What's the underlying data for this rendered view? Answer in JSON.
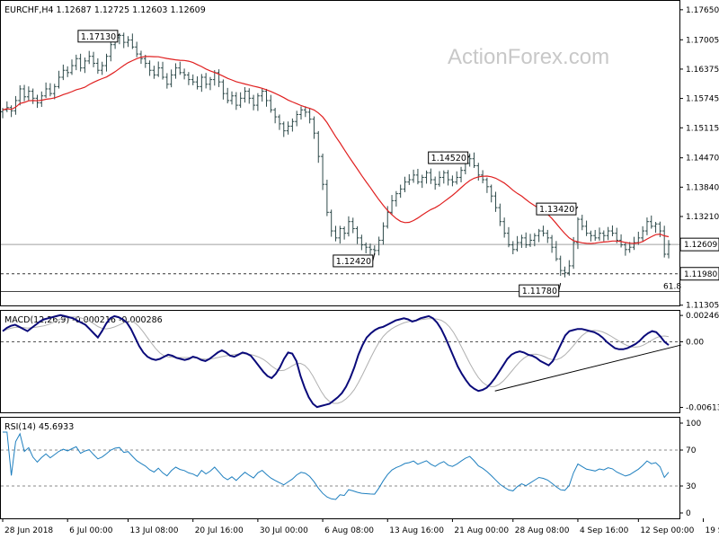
{
  "chart_data": [
    {
      "type": "candlestick",
      "name": "main",
      "symbol_header": "EURCHF,H4  1.12687  1.12725  1.12603  1.12609",
      "watermark": "ActionForex.com",
      "ylim": [
        1.113,
        1.1784
      ],
      "y_ticks": [
        "1.17650",
        "1.17005",
        "1.16375",
        "1.15745",
        "1.15115",
        "1.14470",
        "1.13840",
        "1.13210",
        "1.12580",
        "1.11950",
        "1.11305"
      ],
      "current_price": {
        "label": "1.12609",
        "value": 1.12609
      },
      "support_level": {
        "label": "1.11980",
        "value": 1.1198
      },
      "fib_level": {
        "label": "61.8",
        "value": 1.116
      },
      "annotations": [
        {
          "label": "1.17130",
          "bar": 27,
          "value": 1.1713
        },
        {
          "label": "1.14520",
          "bar": 108,
          "value": 1.1452
        },
        {
          "label": "1.12420",
          "bar": 86,
          "value": 1.1242
        },
        {
          "label": "1.13420",
          "bar": 133,
          "value": 1.1342
        },
        {
          "label": "1.11780",
          "bar": 129,
          "value": 1.1178
        }
      ],
      "close": [
        1.155,
        1.1555,
        1.1548,
        1.157,
        1.1595,
        1.1578,
        1.159,
        1.1575,
        1.1565,
        1.158,
        1.1595,
        1.1585,
        1.16,
        1.162,
        1.1635,
        1.163,
        1.1645,
        1.166,
        1.164,
        1.1655,
        1.1665,
        1.165,
        1.1635,
        1.1645,
        1.1665,
        1.169,
        1.1705,
        1.171,
        1.1695,
        1.17,
        1.1685,
        1.167,
        1.166,
        1.165,
        1.1635,
        1.1625,
        1.164,
        1.162,
        1.1605,
        1.1625,
        1.164,
        1.163,
        1.1625,
        1.1615,
        1.161,
        1.16,
        1.162,
        1.1605,
        1.1615,
        1.163,
        1.161,
        1.1585,
        1.157,
        1.158,
        1.156,
        1.1575,
        1.159,
        1.1575,
        1.156,
        1.158,
        1.159,
        1.157,
        1.155,
        1.1535,
        1.152,
        1.1505,
        1.1515,
        1.1525,
        1.154,
        1.155,
        1.1545,
        1.153,
        1.15,
        1.145,
        1.139,
        1.133,
        1.129,
        1.1275,
        1.1295,
        1.1285,
        1.131,
        1.1295,
        1.1275,
        1.126,
        1.1255,
        1.125,
        1.1248,
        1.127,
        1.13,
        1.133,
        1.1355,
        1.137,
        1.138,
        1.1395,
        1.14,
        1.141,
        1.1395,
        1.1405,
        1.1415,
        1.14,
        1.139,
        1.1405,
        1.1415,
        1.14,
        1.1395,
        1.1405,
        1.142,
        1.1435,
        1.1445,
        1.143,
        1.141,
        1.14,
        1.1385,
        1.1365,
        1.134,
        1.131,
        1.1285,
        1.126,
        1.125,
        1.1265,
        1.1275,
        1.126,
        1.127,
        1.128,
        1.129,
        1.1285,
        1.1275,
        1.1255,
        1.123,
        1.1205,
        1.12,
        1.1215,
        1.1265,
        1.1315,
        1.13,
        1.1285,
        1.128,
        1.1275,
        1.1285,
        1.128,
        1.129,
        1.1285,
        1.127,
        1.126,
        1.125,
        1.1255,
        1.1265,
        1.1275,
        1.129,
        1.131,
        1.13,
        1.1305,
        1.129,
        1.124,
        1.1261
      ],
      "ma_color": "#e02020",
      "bar_color": "#2e4a4a",
      "x_ticks": [
        {
          "label": "28 Jun 2018",
          "bar": 0
        },
        {
          "label": "6 Jul 00:00",
          "bar": 15
        },
        {
          "label": "13 Jul 08:00",
          "bar": 29
        },
        {
          "label": "20 Jul 16:00",
          "bar": 44
        },
        {
          "label": "30 Jul 00:00",
          "bar": 59
        },
        {
          "label": "6 Aug 08:00",
          "bar": 74
        },
        {
          "label": "13 Aug 16:00",
          "bar": 89
        },
        {
          "label": "21 Aug 00:00",
          "bar": 104
        },
        {
          "label": "28 Aug 08:00",
          "bar": 118
        },
        {
          "label": "4 Sep 16:00",
          "bar": 133
        },
        {
          "label": "12 Sep 00:00",
          "bar": 147
        },
        {
          "label": "19 Sep 08:00",
          "bar": 162
        }
      ]
    },
    {
      "type": "line",
      "name": "macd",
      "label": "MACD(12,26,9) -0.000216 -0.000286",
      "ylim": [
        -0.0066,
        0.0029
      ],
      "y_ticks": [
        {
          "label": "0.002469",
          "value": 0.002469
        },
        {
          "label": "0.00",
          "value": 0.0
        },
        {
          "label": "-0.006136",
          "value": -0.006136
        }
      ],
      "macd": [
        0.001,
        0.0013,
        0.0015,
        0.0016,
        0.0014,
        0.0012,
        0.001,
        0.0013,
        0.0016,
        0.0019,
        0.0021,
        0.0022,
        0.0023,
        0.0024,
        0.0025,
        0.0024,
        0.0023,
        0.0022,
        0.002,
        0.0018,
        0.0016,
        0.0012,
        0.0008,
        0.0004,
        0.001,
        0.0017,
        0.0022,
        0.0024,
        0.0023,
        0.0021,
        0.0018,
        0.0012,
        0.0004,
        -0.0004,
        -0.001,
        -0.0014,
        -0.0016,
        -0.0017,
        -0.0016,
        -0.0014,
        -0.0012,
        -0.0013,
        -0.0015,
        -0.0016,
        -0.0017,
        -0.0016,
        -0.0014,
        -0.0015,
        -0.0017,
        -0.0018,
        -0.0016,
        -0.0013,
        -0.001,
        -0.0008,
        -0.001,
        -0.0013,
        -0.0014,
        -0.0012,
        -0.001,
        -0.0011,
        -0.0013,
        -0.0018,
        -0.0023,
        -0.0028,
        -0.0032,
        -0.0034,
        -0.003,
        -0.0024,
        -0.0016,
        -0.001,
        -0.0011,
        -0.0018,
        -0.0032,
        -0.0043,
        -0.0052,
        -0.0058,
        -0.0061,
        -0.006,
        -0.0059,
        -0.0058,
        -0.0055,
        -0.0052,
        -0.0048,
        -0.0042,
        -0.0034,
        -0.0024,
        -0.0012,
        -0.0003,
        0.0004,
        0.0008,
        0.0011,
        0.0013,
        0.0014,
        0.0016,
        0.0018,
        0.002,
        0.0021,
        0.0022,
        0.0021,
        0.0019,
        0.002,
        0.0022,
        0.0023,
        0.0024,
        0.0022,
        0.0018,
        0.0012,
        0.0004,
        -0.0005,
        -0.0014,
        -0.0023,
        -0.003,
        -0.0036,
        -0.0041,
        -0.0044,
        -0.0046,
        -0.0045,
        -0.0043,
        -0.0039,
        -0.0034,
        -0.0028,
        -0.0022,
        -0.0016,
        -0.0012,
        -0.001,
        -0.0009,
        -0.001,
        -0.0012,
        -0.0013,
        -0.0015,
        -0.0018,
        -0.002,
        -0.0022,
        -0.0018,
        -0.001,
        -0.0002,
        0.0006,
        0.001,
        0.0011,
        0.0012,
        0.0012,
        0.0011,
        0.001,
        0.0009,
        0.0007,
        0.0004,
        0.0,
        -0.0003,
        -0.0006,
        -0.0007,
        -0.0007,
        -0.0006,
        -0.0004,
        -0.0002,
        0.0001,
        0.0005,
        0.0008,
        0.001,
        0.0009,
        0.0005,
        0.0,
        -0.0003
      ],
      "signal_delay": 3,
      "trendline_bars": [
        119,
        164
      ],
      "trendline_values": [
        -0.0046,
        -0.0003
      ],
      "macd_color": "#0a0a7a",
      "signal_color": "#b0b0b0"
    },
    {
      "type": "line",
      "name": "rsi",
      "label": "RSI(14) 45.6933",
      "ylim": [
        0,
        100
      ],
      "y_ticks": [
        {
          "label": "100",
          "value": 100
        },
        {
          "label": "70",
          "value": 70
        },
        {
          "label": "30",
          "value": 30
        },
        {
          "label": "0",
          "value": 0
        }
      ],
      "levels": [
        70,
        30
      ],
      "rsi_color": "#1e7fbf"
    }
  ]
}
